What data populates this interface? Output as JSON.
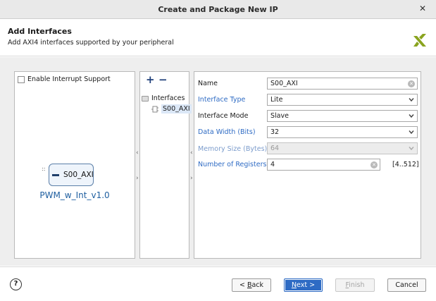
{
  "window": {
    "title": "Create and Package New IP",
    "close_glyph": "✕"
  },
  "header": {
    "title": "Add Interfaces",
    "subtitle": "Add AXI4 interfaces supported by your peripheral",
    "logo_icon": "xilinx-logo-icon",
    "logo_color": "#8aa41f"
  },
  "left_panel": {
    "enable_interrupt_label": "Enable Interrupt Support",
    "enable_interrupt_checked": false,
    "ip_port_label": "S00_AXI",
    "ip_name": "PWM_w_Int_v1.0",
    "ip_dots": "::"
  },
  "middle_panel": {
    "add_glyph": "+",
    "remove_glyph": "−",
    "tree_root": "Interfaces",
    "tree_child": "S00_AXI"
  },
  "right_panel": {
    "fields": {
      "name": {
        "label": "Name",
        "value": "S00_AXI"
      },
      "interface_type": {
        "label": "Interface Type",
        "value": "Lite"
      },
      "interface_mode": {
        "label": "Interface Mode",
        "value": "Slave"
      },
      "data_width": {
        "label": "Data Width (Bits)",
        "value": "32"
      },
      "memory_size": {
        "label": "Memory Size (Bytes)",
        "value": "64"
      },
      "num_registers": {
        "label": "Number of Registers",
        "value": "4",
        "range": "[4..512]"
      }
    }
  },
  "splitter": {
    "collapse_glyph": "‹",
    "expand_glyph": "›"
  },
  "footer": {
    "help_glyph": "?",
    "back_prefix": "< ",
    "back_mnemonic": "B",
    "back_rest": "ack",
    "next_mnemonic": "N",
    "next_rest": "ext >",
    "finish_mnemonic": "F",
    "finish_rest": "inish",
    "cancel_label": "Cancel"
  },
  "colors": {
    "accent": "#2e6bc4",
    "link_label": "#2e6bc4",
    "ip_name": "#1f5fa0"
  }
}
